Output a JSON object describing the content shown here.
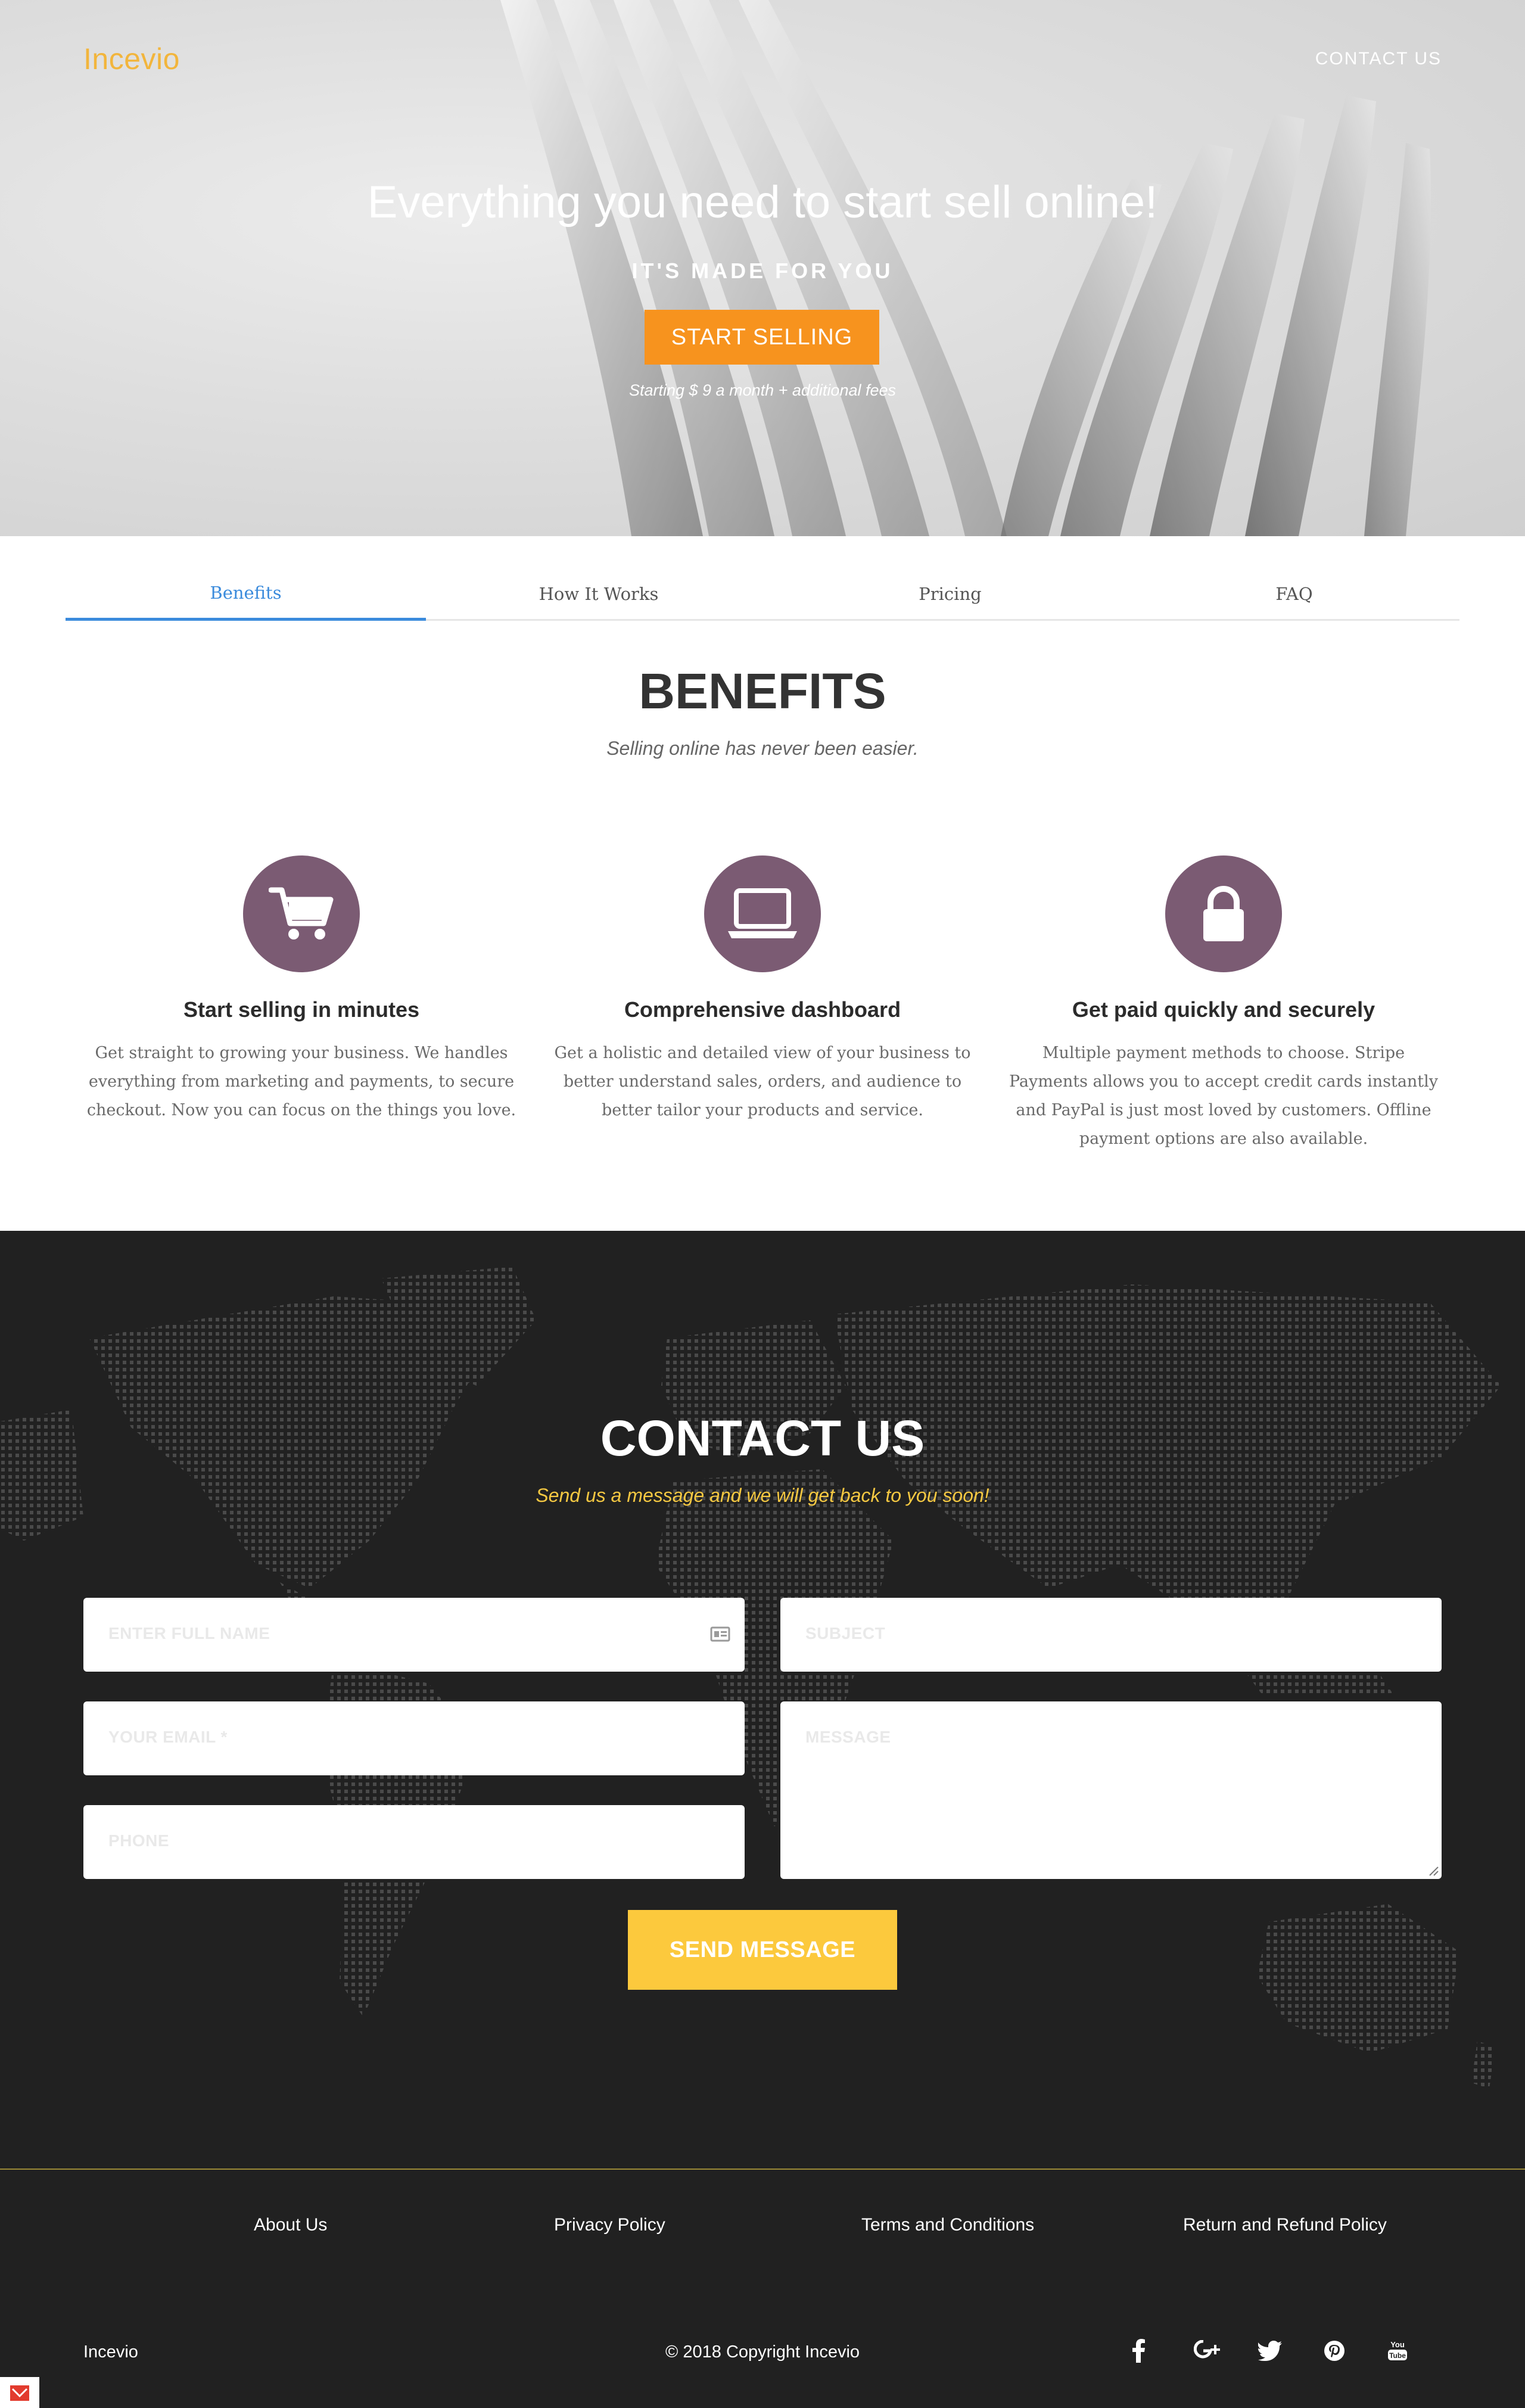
{
  "header": {
    "logo": "Incevio",
    "nav_contact": "CONTACT US"
  },
  "hero": {
    "title": "Everything you need to start sell online!",
    "subtitle": "IT'S MADE FOR YOU",
    "cta": "START SELLING",
    "note": "Starting $ 9 a month + additional fees"
  },
  "tabs": [
    {
      "label": "Benefits",
      "active": true
    },
    {
      "label": "How It Works",
      "active": false
    },
    {
      "label": "Pricing",
      "active": false
    },
    {
      "label": "FAQ",
      "active": false
    }
  ],
  "benefits": {
    "title": "BENEFITS",
    "subtitle": "Selling online has never been easier.",
    "features": [
      {
        "icon": "shopping-cart-icon",
        "title": "Start selling in minutes",
        "lines": [
          "Get straight to growing your business. We handles",
          "everything from marketing and payments, to secure",
          "checkout. Now you can focus on the things you love."
        ]
      },
      {
        "icon": "laptop-icon",
        "title": "Comprehensive dashboard",
        "lines": [
          "Get a holistic and detailed view of your business to",
          "better understand sales, orders, and audience to",
          "better tailor your products and service."
        ]
      },
      {
        "icon": "lock-icon",
        "title": "Get paid quickly and securely",
        "lines": [
          "Multiple payment methods to choose. Stripe",
          "Payments allows you to accept credit cards instantly",
          "and PayPal is just most loved by customers. Offline",
          "payment options are also available."
        ]
      }
    ]
  },
  "contact": {
    "title": "CONTACT US",
    "subtitle": "Send us a message and we will get back to you soon!",
    "fields": {
      "name_placeholder": "ENTER FULL NAME",
      "subject_placeholder": "SUBJECT",
      "email_placeholder": "YOUR EMAIL *",
      "message_placeholder": "MESSAGE",
      "phone_placeholder": "PHONE"
    },
    "send_label": "SEND MESSAGE"
  },
  "footer": {
    "links": [
      "About Us",
      "Privacy Policy",
      "Terms and Conditions",
      "Return and Refund Policy"
    ],
    "brand": "Incevio",
    "copyright": "© 2018 Copyright Incevio",
    "social": [
      "facebook-icon",
      "google-plus-icon",
      "twitter-icon",
      "pinterest-icon",
      "youtube-icon"
    ]
  },
  "colors": {
    "accent_orange": "#f7931e",
    "accent_yellow": "#fcc93d",
    "logo": "#f2b53c",
    "tab_active": "#3b8bdc",
    "icon_circle": "#7b5b73",
    "contact_bg": "#212121"
  }
}
